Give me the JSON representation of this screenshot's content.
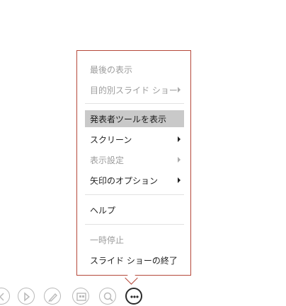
{
  "menu": {
    "items": [
      {
        "label": "最後の表示",
        "disabled": true,
        "submenu": false
      },
      {
        "label": "目的別スライド ショー",
        "disabled": true,
        "submenu": true
      },
      {
        "label": "発表者ツールを表示",
        "disabled": false,
        "submenu": false,
        "highlighted": true
      },
      {
        "label": "スクリーン",
        "disabled": false,
        "submenu": true
      },
      {
        "label": "表示設定",
        "disabled": true,
        "submenu": true
      },
      {
        "label": "矢印のオプション",
        "disabled": false,
        "submenu": true
      },
      {
        "label": "ヘルプ",
        "disabled": false,
        "submenu": false
      },
      {
        "label": "一時停止",
        "disabled": true,
        "submenu": false
      },
      {
        "label": "スライド ショーの終了",
        "disabled": false,
        "submenu": false
      }
    ]
  },
  "toolbar": {
    "icons": [
      "previous-icon",
      "next-icon",
      "pen-icon",
      "slides-icon",
      "zoom-icon",
      "more-icon"
    ]
  }
}
